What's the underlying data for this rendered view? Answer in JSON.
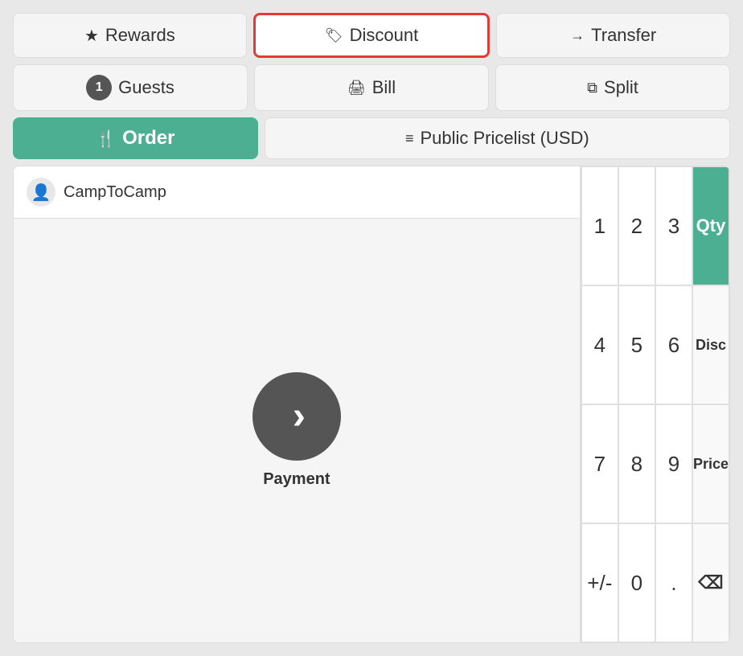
{
  "header": {
    "row1": {
      "rewards": {
        "label": "Rewards",
        "icon": "★"
      },
      "discount": {
        "label": "Discount",
        "icon": "🏷"
      },
      "transfer": {
        "label": "Transfer",
        "icon": "→"
      }
    },
    "row2": {
      "guests": {
        "label": "Guests",
        "badge": "1",
        "icon": "🖨"
      },
      "bill": {
        "label": "Bill",
        "icon": "🖨"
      },
      "split": {
        "label": "Split",
        "icon": "⧉"
      }
    },
    "row3": {
      "order": {
        "label": "Order",
        "icon": "🍴"
      },
      "pricelist": {
        "label": "Public Pricelist (USD)",
        "icon": "≡"
      }
    }
  },
  "order_panel": {
    "customer": "CampToCamp",
    "payment_label": "Payment"
  },
  "numpad": {
    "keys": [
      "1",
      "2",
      "3",
      "4",
      "5",
      "6",
      "7",
      "8",
      "9",
      "+/-",
      "0",
      "."
    ],
    "side_keys": [
      "Qty",
      "Disc",
      "Price",
      "⌫"
    ]
  }
}
